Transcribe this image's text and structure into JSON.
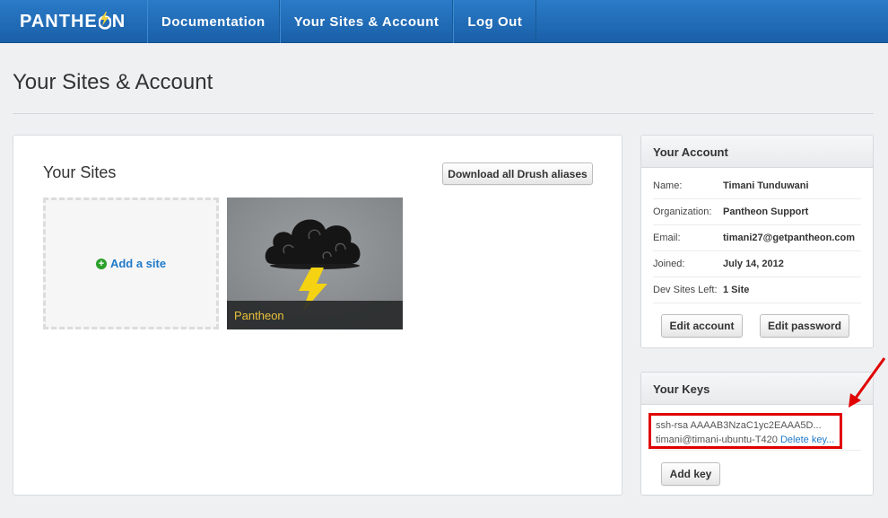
{
  "brand": {
    "logo_text_left": "PANTHE",
    "logo_text_right": "N"
  },
  "nav": {
    "items": [
      {
        "label": "Documentation"
      },
      {
        "label": "Your Sites & Account"
      },
      {
        "label": "Log Out"
      }
    ]
  },
  "page": {
    "title": "Your Sites & Account"
  },
  "sites": {
    "heading": "Your Sites",
    "drush_button": "Download all Drush aliases",
    "add_site_label": "Add a site",
    "tiles": [
      {
        "name": "Pantheon"
      }
    ]
  },
  "account": {
    "heading": "Your Account",
    "rows": [
      {
        "label": "Name:",
        "value": "Timani Tunduwani"
      },
      {
        "label": "Organization:",
        "value": "Pantheon Support"
      },
      {
        "label": "Email:",
        "value": "timani27@getpantheon.com"
      },
      {
        "label": "Joined:",
        "value": "July 14, 2012"
      },
      {
        "label": "Dev Sites Left:",
        "value": "1 Site"
      }
    ],
    "edit_account_button": "Edit account",
    "edit_password_button": "Edit password"
  },
  "keys": {
    "heading": "Your Keys",
    "items": [
      {
        "key_line": "ssh-rsa AAAAB3NzaC1yc2EAAA5D...",
        "host": "timani@timani-ubuntu-T420",
        "delete_label": "Delete key..."
      }
    ],
    "add_key_button": "Add key"
  },
  "colors": {
    "nav_bg": "#1f6bb5",
    "annotation_red": "#e00000",
    "link": "#1f7ac9",
    "tile_caption": "#e8c03a"
  }
}
